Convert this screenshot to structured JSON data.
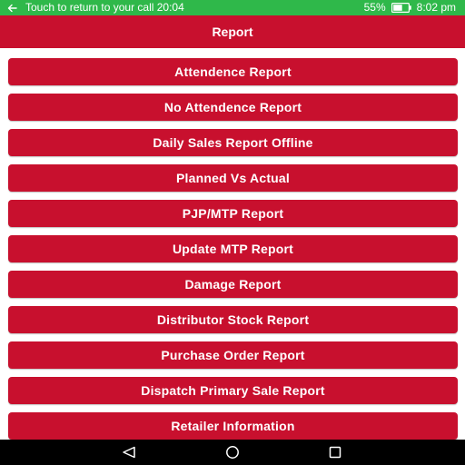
{
  "status_bar": {
    "call_text": "Touch to return to your call 20:04",
    "battery_percent": "55%",
    "time": "8:02 pm",
    "color": "#2fb84a",
    "icons": [
      "back-arrow-icon",
      "battery-icon"
    ]
  },
  "app_bar": {
    "title": "Report",
    "color": "#c8102e"
  },
  "menu": {
    "items": [
      {
        "label": "Attendence Report"
      },
      {
        "label": "No Attendence Report"
      },
      {
        "label": "Daily Sales Report Offline"
      },
      {
        "label": "Planned Vs Actual"
      },
      {
        "label": "PJP/MTP Report"
      },
      {
        "label": "Update MTP Report"
      },
      {
        "label": "Damage Report"
      },
      {
        "label": "Distributor Stock Report"
      },
      {
        "label": "Purchase Order Report"
      },
      {
        "label": "Dispatch Primary Sale Report"
      },
      {
        "label": "Retailer Information"
      }
    ]
  },
  "nav_bar": {
    "icons": [
      "back-triangle-icon",
      "home-circle-icon",
      "recents-square-icon"
    ]
  }
}
